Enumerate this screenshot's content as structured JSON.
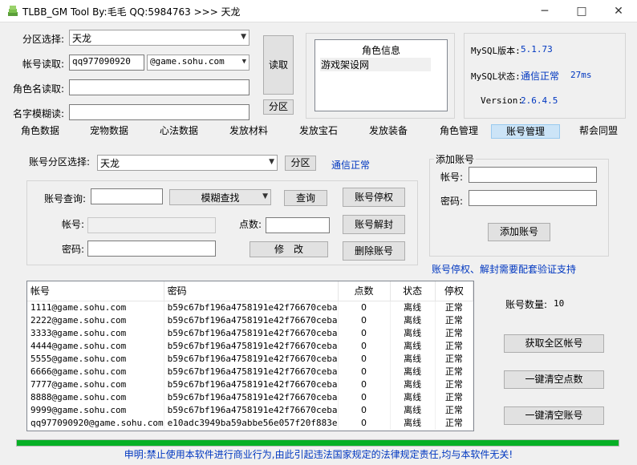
{
  "window": {
    "title": "TLBB_GM Tool By:毛毛 QQ:5984763 >>> 天龙",
    "minimize": "─",
    "maximize": "□",
    "close": "✕",
    "icon": "cube-stack-icon"
  },
  "top": {
    "zone_label": "分区选择:",
    "zone_value": "天龙",
    "account_label": "帐号读取:",
    "account_value": "qq977090920",
    "domain_value": "@game.sohu.com",
    "rolename_label": "角色名读取:",
    "rolename_value": "",
    "fuzzy_label": "名字模糊读:",
    "fuzzy_value": "",
    "read_button": "读取",
    "zone_button": "分区"
  },
  "role_info": {
    "title": "角色信息",
    "item": "游戏架设网"
  },
  "mysql": {
    "version_label": "MySQL版本:",
    "version_value": "5.1.73",
    "status_label": "MySQL状态:",
    "status_value": "通信正常",
    "status_ms": "27ms",
    "ver_label": "Version:",
    "ver_value": "2.6.4.5"
  },
  "tabs": [
    {
      "label": "角色数据"
    },
    {
      "label": "宠物数据"
    },
    {
      "label": "心法数据"
    },
    {
      "label": "发放材料"
    },
    {
      "label": "发放宝石"
    },
    {
      "label": "发放装备"
    },
    {
      "label": "角色管理"
    },
    {
      "label": "账号管理"
    },
    {
      "label": "帮会同盟"
    }
  ],
  "acct": {
    "zone_label": "账号分区选择:",
    "zone_value": "天龙",
    "zone_button": "分区",
    "conn_status": "通信正常",
    "query_label": "账号查询:",
    "query_value": "",
    "fuzzy_combo": "模糊查找",
    "query_button": "查询",
    "suspend_button": "账号停权",
    "account_label": "帐号:",
    "account_value": "",
    "points_label": "点数:",
    "points_value": "",
    "unban_button": "账号解封",
    "password_label": "密码:",
    "password_value": "",
    "modify_button": "修　改",
    "delete_button": "删除账号"
  },
  "add": {
    "title": "添加账号",
    "account_label": "帐号:",
    "account_value": "",
    "password_label": "密码:",
    "password_value": "",
    "button": "添加账号"
  },
  "notice": "账号停权、解封需要配套验证支持",
  "table": {
    "headers": [
      "帐号",
      "密码",
      "点数",
      "状态",
      "停权"
    ],
    "rows": [
      [
        "1111@game.sohu.com",
        "b59c67bf196a4758191e42f76670ceba",
        "0",
        "离线",
        "正常"
      ],
      [
        "2222@game.sohu.com",
        "b59c67bf196a4758191e42f76670ceba",
        "0",
        "离线",
        "正常"
      ],
      [
        "3333@game.sohu.com",
        "b59c67bf196a4758191e42f76670ceba",
        "0",
        "离线",
        "正常"
      ],
      [
        "4444@game.sohu.com",
        "b59c67bf196a4758191e42f76670ceba",
        "0",
        "离线",
        "正常"
      ],
      [
        "5555@game.sohu.com",
        "b59c67bf196a4758191e42f76670ceba",
        "0",
        "离线",
        "正常"
      ],
      [
        "6666@game.sohu.com",
        "b59c67bf196a4758191e42f76670ceba",
        "0",
        "离线",
        "正常"
      ],
      [
        "7777@game.sohu.com",
        "b59c67bf196a4758191e42f76670ceba",
        "0",
        "离线",
        "正常"
      ],
      [
        "8888@game.sohu.com",
        "b59c67bf196a4758191e42f76670ceba",
        "0",
        "离线",
        "正常"
      ],
      [
        "9999@game.sohu.com",
        "b59c67bf196a4758191e42f76670ceba",
        "0",
        "离线",
        "正常"
      ],
      [
        "qq977090920@game.sohu.com",
        "e10adc3949ba59abbe56e057f20f883e",
        "0",
        "离线",
        "正常"
      ]
    ]
  },
  "right": {
    "count_label": "账号数量:",
    "count_value": "10",
    "get_all": "获取全区帐号",
    "clear_points": "一键清空点数",
    "clear_accounts": "一键清空账号"
  },
  "progress": {
    "value": 1.0
  },
  "status": "申明:禁止使用本软件进行商业行为,由此引起违法国家规定的法律规定责任,均与本软件无关!"
}
